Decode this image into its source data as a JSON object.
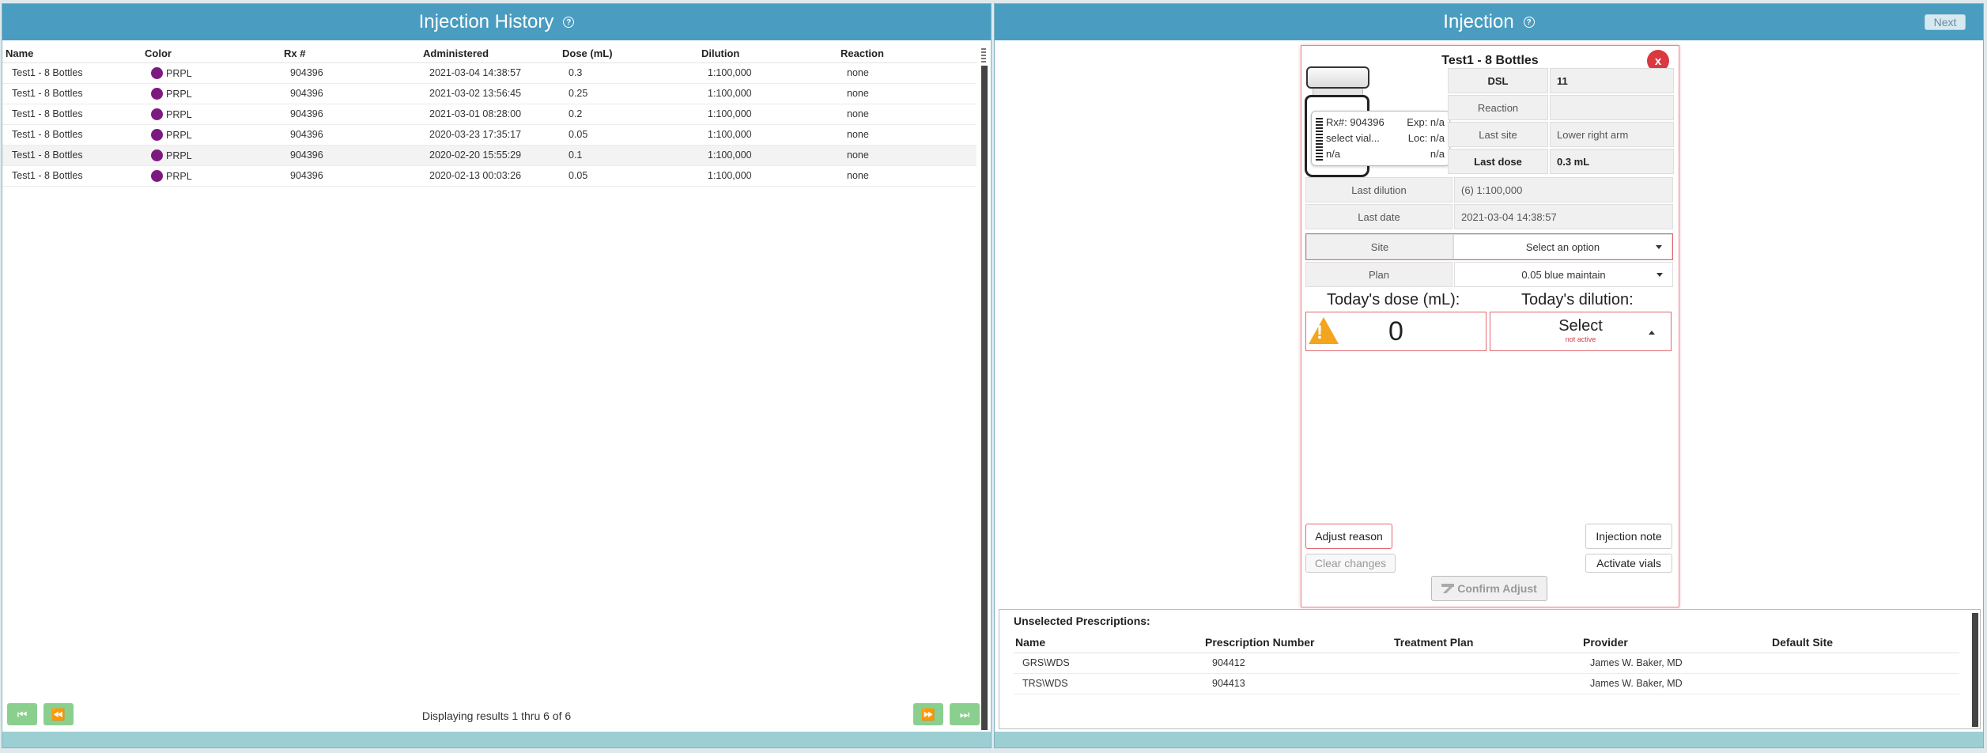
{
  "history": {
    "title": "Injection History",
    "help_icon": "?",
    "columns": [
      "Name",
      "Color",
      "Rx #",
      "Administered",
      "Dose (mL)",
      "Dilution",
      "Reaction"
    ],
    "rows": [
      {
        "name": "Test1 - 8 Bottles",
        "color": "PRPL",
        "rx": "904396",
        "administered": "2021-03-04 14:38:57",
        "dose": "0.3",
        "dilution": "1:100,000",
        "reaction": "none"
      },
      {
        "name": "Test1 - 8 Bottles",
        "color": "PRPL",
        "rx": "904396",
        "administered": "2021-03-02 13:56:45",
        "dose": "0.25",
        "dilution": "1:100,000",
        "reaction": "none"
      },
      {
        "name": "Test1 - 8 Bottles",
        "color": "PRPL",
        "rx": "904396",
        "administered": "2021-03-01 08:28:00",
        "dose": "0.2",
        "dilution": "1:100,000",
        "reaction": "none"
      },
      {
        "name": "Test1 - 8 Bottles",
        "color": "PRPL",
        "rx": "904396",
        "administered": "2020-03-23 17:35:17",
        "dose": "0.05",
        "dilution": "1:100,000",
        "reaction": "none"
      },
      {
        "name": "Test1 - 8 Bottles",
        "color": "PRPL",
        "rx": "904396",
        "administered": "2020-02-20 15:55:29",
        "dose": "0.1",
        "dilution": "1:100,000",
        "reaction": "none"
      },
      {
        "name": "Test1 - 8 Bottles",
        "color": "PRPL",
        "rx": "904396",
        "administered": "2020-02-13 00:03:26",
        "dose": "0.05",
        "dilution": "1:100,000",
        "reaction": "none"
      }
    ],
    "color_hex": "#7d1a80",
    "pager_text": "Displaying results 1 thru 6 of 6",
    "pager_icons": {
      "first": "⏮",
      "prev": "⏪",
      "next": "⏩",
      "last": "⏭"
    }
  },
  "injection": {
    "title": "Injection",
    "help_icon": "?",
    "next_label": "Next",
    "card_title": "Test1 - 8 Bottles",
    "close_label": "x",
    "vial": {
      "rx": "Rx#: 904396",
      "exp": "Exp: n/a",
      "select": "select vial...",
      "loc": "Loc: n/a",
      "left3": "n/a",
      "right3": "n/a"
    },
    "dsl_label": "DSL",
    "dsl_value": "11",
    "reaction_label": "Reaction",
    "reaction_value": "",
    "last_site_label": "Last site",
    "last_site_value": "Lower right arm",
    "last_dose_label": "Last dose",
    "last_dose_value": "0.3 mL",
    "last_dilution_label": "Last dilution",
    "last_dilution_value": "(6) 1:100,000",
    "last_date_label": "Last date",
    "last_date_value": "2021-03-04 14:38:57",
    "site_label": "Site",
    "site_value": "Select an option",
    "plan_label": "Plan",
    "plan_value": "0.05 blue maintain",
    "today_dose_label": "Today's dose (mL):",
    "today_dilution_label": "Today's dilution:",
    "dose_value": "0",
    "dilution_select": "Select",
    "dilution_status": "not active",
    "adjust_reason": "Adjust reason",
    "injection_note": "Injection note",
    "clear_changes": "Clear changes",
    "activate_vials": "Activate vials",
    "confirm_adjust": "Confirm Adjust",
    "accent_red": "#d9393f",
    "warning_color": "#f2a51d"
  },
  "unselected": {
    "title": "Unselected Prescriptions:",
    "columns": [
      "Name",
      "Prescription Number",
      "Treatment Plan",
      "Provider",
      "Default Site"
    ],
    "rows": [
      {
        "name": "GRS\\WDS",
        "number": "904412",
        "plan": "",
        "provider": "James W. Baker, MD",
        "site": ""
      },
      {
        "name": "TRS\\WDS",
        "number": "904413",
        "plan": "",
        "provider": "James W. Baker, MD",
        "site": ""
      }
    ]
  }
}
